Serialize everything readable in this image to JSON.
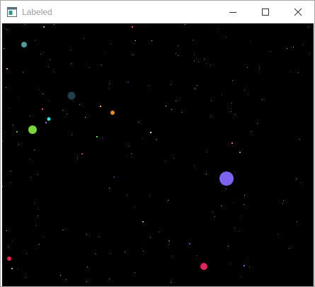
{
  "window": {
    "title": "Labeled",
    "icons": {
      "app": "app-window-icon",
      "minimize": "minimize-icon",
      "maximize": "maximize-icon",
      "close": "close-icon"
    }
  },
  "colors": {
    "titlebar_bg": "#ffffff",
    "title_text": "#9a9a9a",
    "canvas_bg": "#000000"
  },
  "bodies": [
    {
      "color": "#7e63f0"
    },
    {
      "color": "#7ad63c"
    },
    {
      "color": "#243d4e"
    },
    {
      "color": "#4f9a9c"
    },
    {
      "color": "#e0265e"
    },
    {
      "color": "#e0264e"
    },
    {
      "color": "#e58c2a"
    },
    {
      "color": "#33e2e2"
    }
  ]
}
